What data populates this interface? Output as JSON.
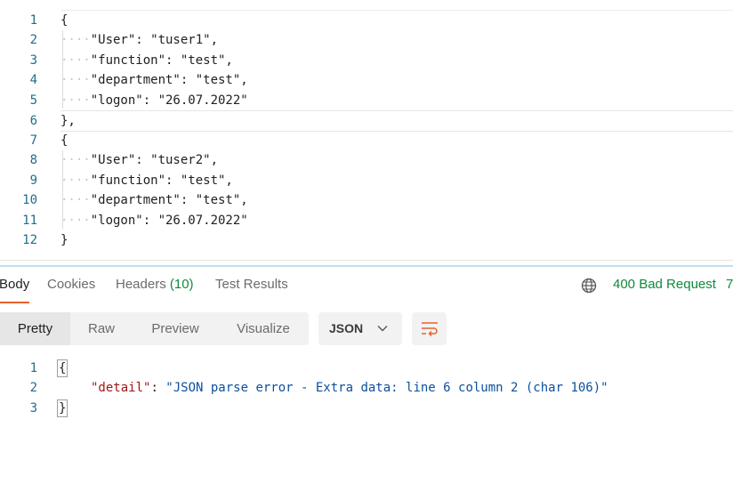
{
  "request_body": {
    "lines": [
      {
        "n": "1",
        "text": "{"
      },
      {
        "n": "2",
        "dots": "····",
        "text": "\"User\": \"tuser1\","
      },
      {
        "n": "3",
        "dots": "····",
        "text": "\"function\": \"test\","
      },
      {
        "n": "4",
        "dots": "····",
        "text": "\"department\": \"test\","
      },
      {
        "n": "5",
        "dots": "····",
        "text": "\"logon\": \"26.07.2022\""
      },
      {
        "n": "6",
        "text": "},"
      },
      {
        "n": "7",
        "text": "{"
      },
      {
        "n": "8",
        "dots": "····",
        "text": "\"User\": \"tuser2\","
      },
      {
        "n": "9",
        "dots": "····",
        "text": "\"function\": \"test\","
      },
      {
        "n": "10",
        "dots": "····",
        "text": "\"department\": \"test\","
      },
      {
        "n": "11",
        "dots": "····",
        "text": "\"logon\": \"26.07.2022\""
      },
      {
        "n": "12",
        "text": "}"
      }
    ]
  },
  "response": {
    "tabs": {
      "body": "Body",
      "cookies": "Cookies",
      "headers": "Headers",
      "headers_count": "(10)",
      "test_results": "Test Results"
    },
    "status": "400 Bad Request",
    "status_extra": "7",
    "format": {
      "modes": [
        "Pretty",
        "Raw",
        "Preview",
        "Visualize"
      ],
      "language": "JSON"
    },
    "body_lines": [
      {
        "n": "1",
        "text": "{"
      },
      {
        "n": "2",
        "key": "\"detail\"",
        "sep": ": ",
        "value": "\"JSON parse error - Extra data: line 6 column 2 (char 106)\""
      },
      {
        "n": "3",
        "text": "}"
      }
    ]
  },
  "colors": {
    "accent": "#e8622a",
    "status_ok": "#0f8a3c",
    "line_number": "#1f6f8b"
  }
}
